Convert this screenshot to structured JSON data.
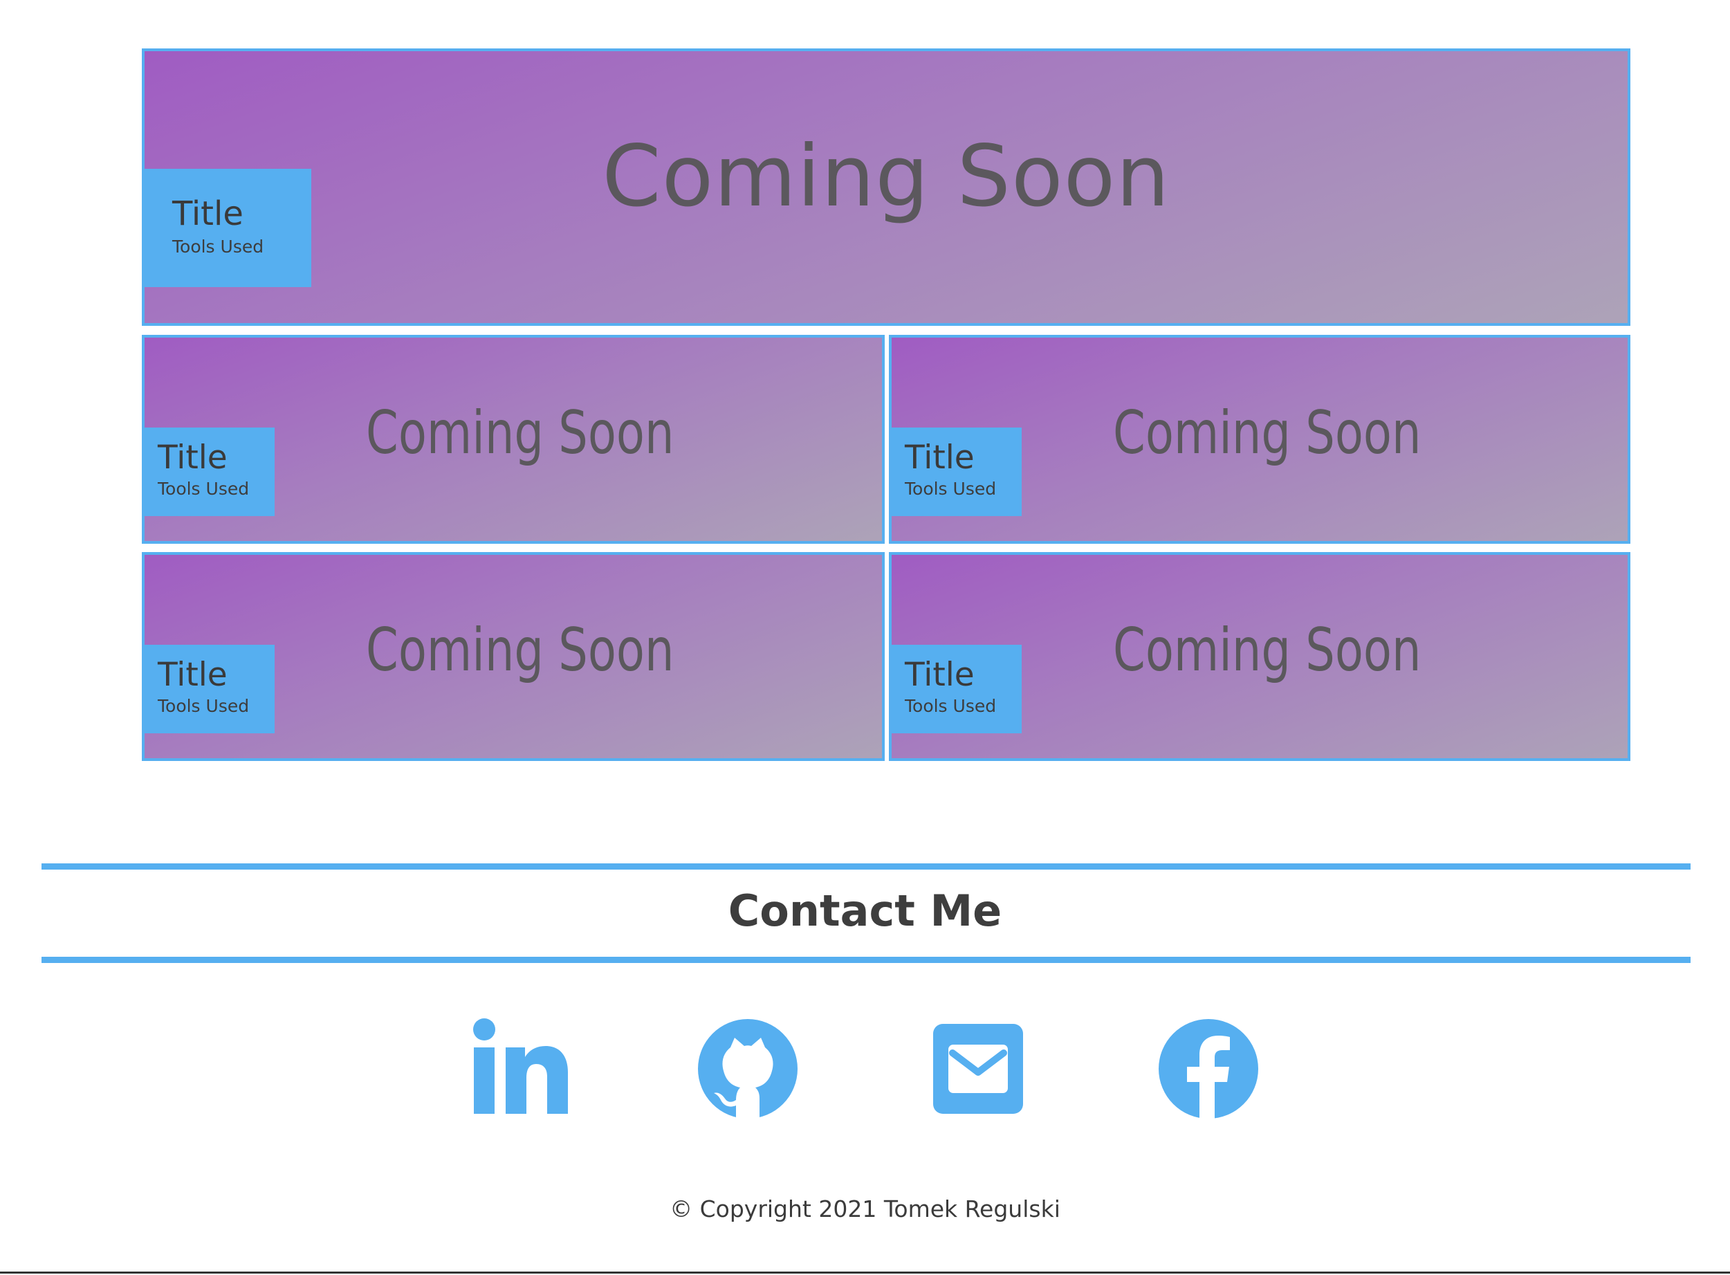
{
  "projects": [
    {
      "title": "Title",
      "tools": "Tools Used",
      "image_text": "Coming Soon"
    },
    {
      "title": "Title",
      "tools": "Tools Used",
      "image_text": "Coming Soon"
    },
    {
      "title": "Title",
      "tools": "Tools Used",
      "image_text": "Coming Soon"
    },
    {
      "title": "Title",
      "tools": "Tools Used",
      "image_text": "Coming Soon"
    },
    {
      "title": "Title",
      "tools": "Tools Used",
      "image_text": "Coming Soon"
    }
  ],
  "contact": {
    "heading": "Contact Me",
    "links": [
      {
        "name": "linkedin",
        "icon": "linkedin-icon"
      },
      {
        "name": "github",
        "icon": "github-icon"
      },
      {
        "name": "email",
        "icon": "mail-icon"
      },
      {
        "name": "facebook",
        "icon": "facebook-icon"
      }
    ]
  },
  "footer": {
    "copyright": "© Copyright 2021 Tomek Regulski"
  },
  "colors": {
    "accent": "#56aff0",
    "gradient_start": "#a05cc2",
    "gradient_end": "#ada3b8",
    "text": "#444444"
  }
}
